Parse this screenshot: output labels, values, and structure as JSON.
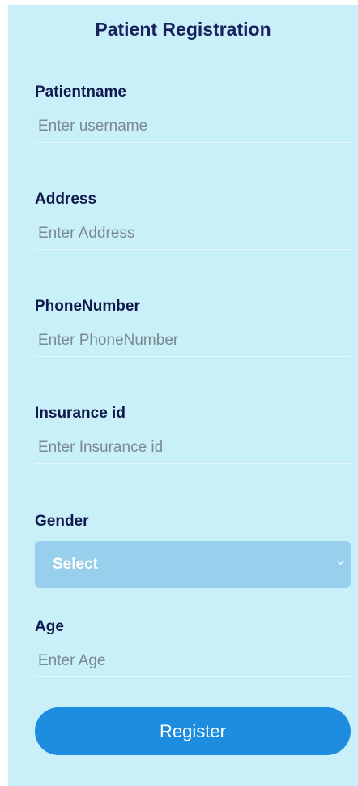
{
  "form": {
    "title": "Patient Registration",
    "fields": {
      "patientname": {
        "label": "Patientname",
        "placeholder": "Enter username"
      },
      "address": {
        "label": "Address",
        "placeholder": "Enter Address"
      },
      "phone": {
        "label": "PhoneNumber",
        "placeholder": "Enter PhoneNumber"
      },
      "insurance": {
        "label": "Insurance id",
        "placeholder": "Enter Insurance id"
      },
      "gender": {
        "label": "Gender",
        "selected": "Select"
      },
      "age": {
        "label": "Age",
        "placeholder": "Enter Age"
      }
    },
    "submit_label": "Register"
  },
  "colors": {
    "panel_background": "#c9eff8",
    "title_text": "#18225e",
    "label_text": "#111a4d",
    "select_background": "#98cfec",
    "button_background": "#1e8ddf"
  },
  "icons": {
    "gender_dropdown": "chevron-down-icon"
  }
}
